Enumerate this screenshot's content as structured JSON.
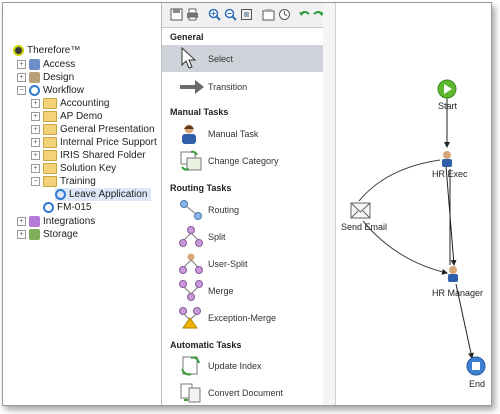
{
  "tree": {
    "root": "Therefore™",
    "items": [
      {
        "label": "Access",
        "icon": "access-icon"
      },
      {
        "label": "Design",
        "icon": "design-icon"
      },
      {
        "label": "Workflow",
        "icon": "workflow-icon"
      },
      {
        "label": "Accounting",
        "icon": "folder-icon"
      },
      {
        "label": "AP Demo",
        "icon": "folder-icon"
      },
      {
        "label": "General Presentation",
        "icon": "folder-icon"
      },
      {
        "label": "Internal Price Support",
        "icon": "folder-icon"
      },
      {
        "label": "IRIS Shared Folder",
        "icon": "folder-icon"
      },
      {
        "label": "Solution Key",
        "icon": "folder-icon"
      },
      {
        "label": "Training",
        "icon": "folder-icon"
      },
      {
        "label": "Leave Application",
        "icon": "workflow-process-icon"
      },
      {
        "label": "FM-015",
        "icon": "workflow-process-icon"
      },
      {
        "label": "Integrations",
        "icon": "integrations-icon"
      },
      {
        "label": "Storage",
        "icon": "storage-icon"
      }
    ]
  },
  "toolbox": {
    "sections": {
      "general": "General",
      "manual": "Manual Tasks",
      "routing": "Routing Tasks",
      "automatic": "Automatic Tasks"
    },
    "tools": {
      "select": "Select",
      "transition": "Transition",
      "manual_task": "Manual Task",
      "change_category": "Change Category",
      "routing": "Routing",
      "split": "Split",
      "user_split": "User-Split",
      "merge": "Merge",
      "exception_merge": "Exception-Merge",
      "update_index": "Update Index",
      "convert_document": "Convert Document"
    }
  },
  "canvas": {
    "start": "Start",
    "hr_exec": "HR Exec",
    "send_email": "Send Email",
    "hr_manager": "HR Manager",
    "end": "End"
  },
  "colors": {
    "start_green": "#5cb82e",
    "end_blue": "#3f7fd0",
    "selected_tool": "#cfd3d9",
    "folder": "#f3d27a"
  }
}
